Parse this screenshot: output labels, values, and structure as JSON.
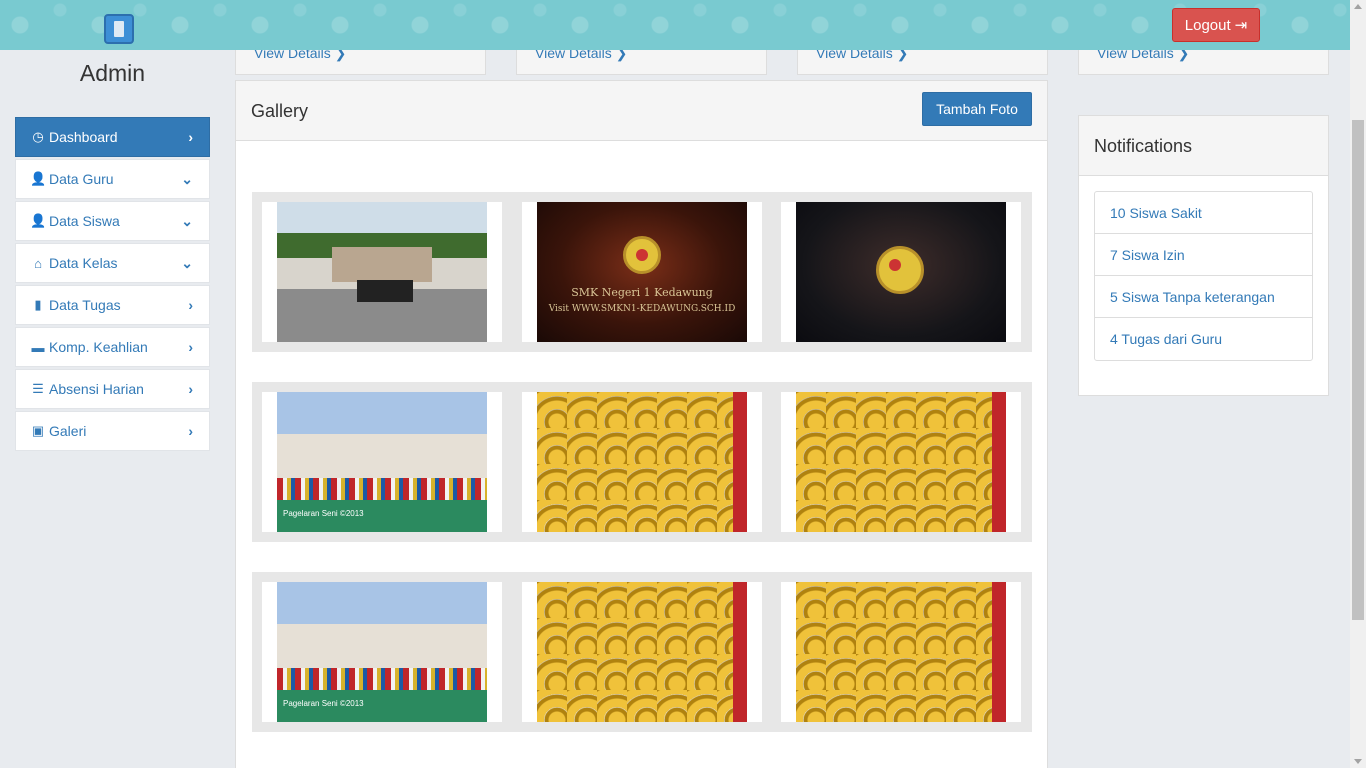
{
  "header": {
    "logout_label": "Logout",
    "logout_icon": "sign-out-icon",
    "background_color": "#79cad0",
    "logout_color": "#d9534f"
  },
  "sidebar": {
    "title": "Admin",
    "accent_color": "#337ab7",
    "items": [
      {
        "label": "Dashboard",
        "icon": "dashboard-icon",
        "glyph": "◷",
        "chevron": "›",
        "active": true
      },
      {
        "label": "Data Guru",
        "icon": "user-icon",
        "glyph": "👤",
        "chevron": "⌄"
      },
      {
        "label": "Data Siswa",
        "icon": "user-icon",
        "glyph": "👤",
        "chevron": "⌄"
      },
      {
        "label": "Data Kelas",
        "icon": "home-icon",
        "glyph": "⌂",
        "chevron": "⌄"
      },
      {
        "label": "Data Tugas",
        "icon": "book-icon",
        "glyph": "▮",
        "chevron": "›"
      },
      {
        "label": "Komp. Keahlian",
        "icon": "briefcase-icon",
        "glyph": "▬",
        "chevron": "›"
      },
      {
        "label": "Absensi Harian",
        "icon": "list-icon",
        "glyph": "☰",
        "chevron": "›"
      },
      {
        "label": "Galeri",
        "icon": "picture-icon",
        "glyph": "▣",
        "chevron": "›"
      }
    ]
  },
  "stat_cards": [
    {
      "link": "View Details ❯"
    },
    {
      "link": "View Details ❯"
    },
    {
      "link": "View Details ❯"
    },
    {
      "link": "View Details ❯"
    }
  ],
  "gallery": {
    "title": "Gallery",
    "add_button": "Tambah Foto",
    "photos": [
      {
        "caption": ""
      },
      {
        "caption": "SMK Negeri 1 Kedawung",
        "caption2": "Visit WWW.SMKN1-KEDAWUNG.SCH.ID"
      },
      {
        "caption": ""
      },
      {
        "caption": "Pagelaran Seni ©2013"
      },
      {
        "caption": ""
      },
      {
        "caption": ""
      },
      {
        "caption": "Pagelaran Seni ©2013"
      },
      {
        "caption": ""
      },
      {
        "caption": ""
      }
    ]
  },
  "notifications": {
    "title": "Notifications",
    "items": [
      "10 Siswa Sakit",
      "7 Siswa Izin",
      "5 Siswa Tanpa keterangan",
      "4 Tugas dari Guru"
    ]
  }
}
